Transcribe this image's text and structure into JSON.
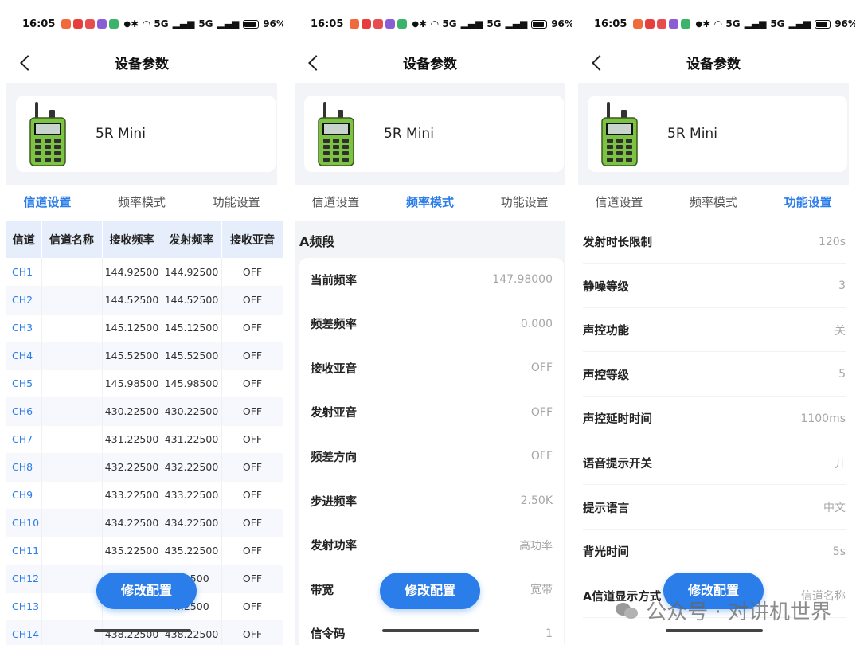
{
  "status": {
    "time": "16:05",
    "signal_label": "5G",
    "battery": "96%"
  },
  "header": {
    "title": "设备参数"
  },
  "device": {
    "name": "5R Mini"
  },
  "tabs": [
    "信道设置",
    "频率模式",
    "功能设置"
  ],
  "channel_table": {
    "columns": [
      "信道",
      "信道名称",
      "接收频率",
      "发射频率",
      "接收亚音"
    ],
    "rows": [
      {
        "ch": "CH1",
        "name": "",
        "rx": "144.92500",
        "tx": "144.92500",
        "tone": "OFF"
      },
      {
        "ch": "CH2",
        "name": "",
        "rx": "144.52500",
        "tx": "144.52500",
        "tone": "OFF"
      },
      {
        "ch": "CH3",
        "name": "",
        "rx": "145.12500",
        "tx": "145.12500",
        "tone": "OFF"
      },
      {
        "ch": "CH4",
        "name": "",
        "rx": "145.52500",
        "tx": "145.52500",
        "tone": "OFF"
      },
      {
        "ch": "CH5",
        "name": "",
        "rx": "145.98500",
        "tx": "145.98500",
        "tone": "OFF"
      },
      {
        "ch": "CH6",
        "name": "",
        "rx": "430.22500",
        "tx": "430.22500",
        "tone": "OFF"
      },
      {
        "ch": "CH7",
        "name": "",
        "rx": "431.22500",
        "tx": "431.22500",
        "tone": "OFF"
      },
      {
        "ch": "CH8",
        "name": "",
        "rx": "432.22500",
        "tx": "432.22500",
        "tone": "OFF"
      },
      {
        "ch": "CH9",
        "name": "",
        "rx": "433.22500",
        "tx": "433.22500",
        "tone": "OFF"
      },
      {
        "ch": "CH10",
        "name": "",
        "rx": "434.22500",
        "tx": "434.22500",
        "tone": "OFF"
      },
      {
        "ch": "CH11",
        "name": "",
        "rx": "435.22500",
        "tx": "435.22500",
        "tone": "OFF"
      },
      {
        "ch": "CH12",
        "name": "",
        "rx": "",
        "tx": "…2500",
        "tone": "OFF"
      },
      {
        "ch": "CH13",
        "name": "",
        "rx": "",
        "tx": "…2500",
        "tone": "OFF"
      },
      {
        "ch": "CH14",
        "name": "",
        "rx": "438.22500",
        "tx": "438.22500",
        "tone": "OFF"
      }
    ]
  },
  "freq_mode": {
    "section": "A频段",
    "items": [
      {
        "label": "当前频率",
        "value": "147.98000"
      },
      {
        "label": "频差频率",
        "value": "0.000"
      },
      {
        "label": "接收亚音",
        "value": "OFF"
      },
      {
        "label": "发射亚音",
        "value": "OFF"
      },
      {
        "label": "频差方向",
        "value": "OFF"
      },
      {
        "label": "步进频率",
        "value": "2.50K"
      },
      {
        "label": "发射功率",
        "value": "高功率"
      },
      {
        "label": "带宽",
        "value": "宽带"
      },
      {
        "label": "信令码",
        "value": "1"
      }
    ]
  },
  "functions": {
    "items": [
      {
        "label": "发射时长限制",
        "value": "120s"
      },
      {
        "label": "静噪等级",
        "value": "3"
      },
      {
        "label": "声控功能",
        "value": "关"
      },
      {
        "label": "声控等级",
        "value": "5"
      },
      {
        "label": "声控延时时间",
        "value": "1100ms"
      },
      {
        "label": "语音提示开关",
        "value": "开"
      },
      {
        "label": "提示语言",
        "value": "中文"
      },
      {
        "label": "背光时间",
        "value": "5s"
      },
      {
        "label": "A信道显示方式",
        "value": "信道名称"
      }
    ]
  },
  "action_button": {
    "label": "修改配置"
  },
  "watermark": {
    "text": "公众号 · 对讲机世界"
  },
  "colors": {
    "accent": "#2b7de9",
    "table_header": "#e6eefb",
    "radio_green": "#7cc243",
    "card_bg": "#f3f4f7"
  }
}
